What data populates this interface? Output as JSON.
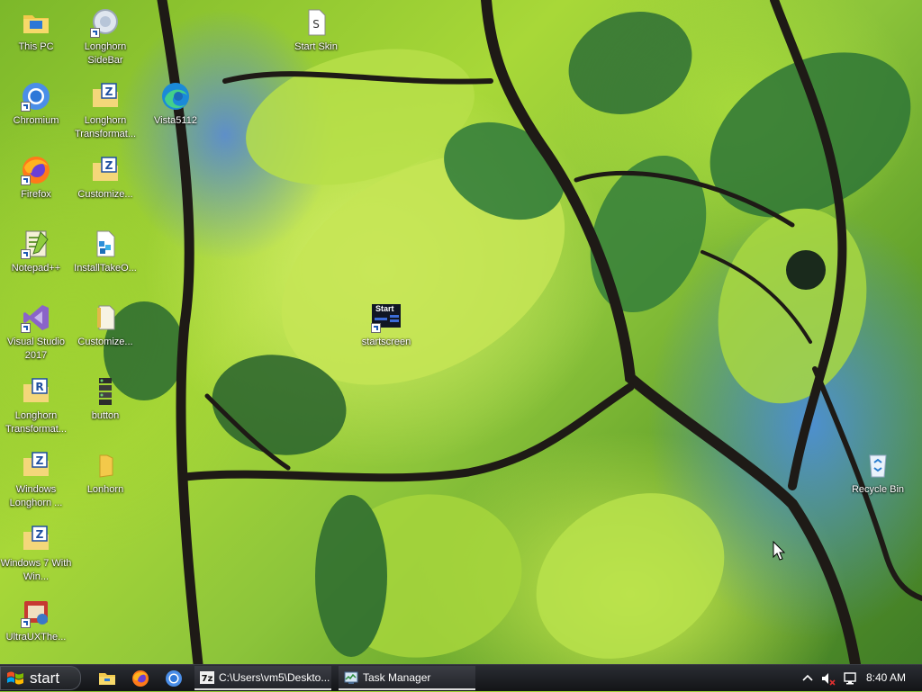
{
  "desktop": {
    "icons": [
      {
        "label": "This PC"
      },
      {
        "label": "Longhorn SideBar"
      },
      {
        "label": "Start Skin"
      },
      {
        "label": "Chromium"
      },
      {
        "label": "Longhorn Transformat..."
      },
      {
        "label": "Vista5112"
      },
      {
        "label": "Firefox"
      },
      {
        "label": "Customize..."
      },
      {
        "label": "Notepad++"
      },
      {
        "label": "InstallTakeO..."
      },
      {
        "label": "Visual Studio 2017"
      },
      {
        "label": "Customize..."
      },
      {
        "label": "startscreen",
        "badge": "Start"
      },
      {
        "label": "Longhorn Transformat..."
      },
      {
        "label": "button"
      },
      {
        "label": "Windows Longhorn ..."
      },
      {
        "label": "Lonhorn"
      },
      {
        "label": "Recycle Bin"
      },
      {
        "label": "Windows 7 With Win..."
      },
      {
        "label": "UltraUXThe..."
      }
    ]
  },
  "taskbar": {
    "start_label": "start",
    "quick_launch": [
      {
        "icon": "file-explorer-icon"
      },
      {
        "icon": "firefox-icon"
      },
      {
        "icon": "chromium-icon"
      }
    ],
    "tasks": [
      {
        "label": "C:\\Users\\vm5\\Deskto...",
        "icon": "7zip-icon"
      },
      {
        "label": "Task Manager",
        "icon": "task-manager-icon"
      }
    ],
    "tray": {
      "icons": [
        "show-hidden-icons-chevron",
        "volume-muted-icon",
        "network-icon"
      ],
      "clock": "8:40 AM"
    }
  }
}
